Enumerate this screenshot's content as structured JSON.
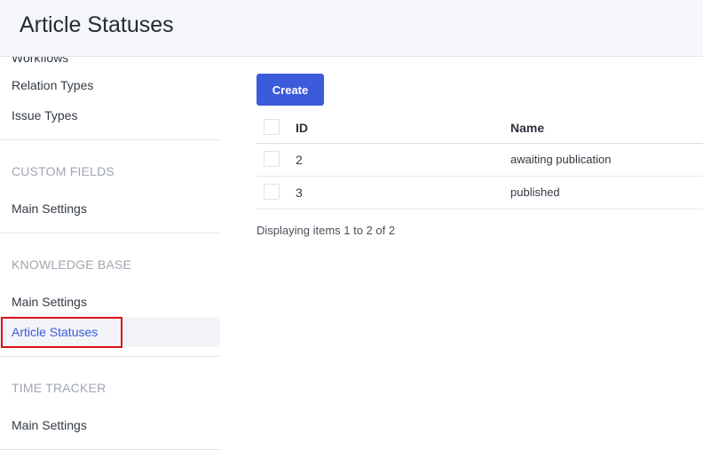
{
  "header": {
    "title": "Article Statuses"
  },
  "sidebar": {
    "items_top": [
      {
        "label": "Workflows"
      },
      {
        "label": "Relation Types"
      },
      {
        "label": "Issue Types"
      }
    ],
    "sections": [
      {
        "title": "CUSTOM FIELDS",
        "items": [
          {
            "label": "Main Settings"
          }
        ]
      },
      {
        "title": "KNOWLEDGE BASE",
        "items": [
          {
            "label": "Main Settings"
          },
          {
            "label": "Article Statuses",
            "active": true
          }
        ]
      },
      {
        "title": "TIME TRACKER",
        "items": [
          {
            "label": "Main Settings"
          }
        ]
      }
    ],
    "accent_color": "#3b5bdb",
    "highlight_color": "#e0101a"
  },
  "main": {
    "create_label": "Create",
    "table": {
      "columns": [
        "ID",
        "Name"
      ],
      "rows": [
        {
          "id": "2",
          "name": "awaiting publication"
        },
        {
          "id": "3",
          "name": "published"
        }
      ]
    },
    "footer": "Displaying items 1 to 2 of 2"
  }
}
